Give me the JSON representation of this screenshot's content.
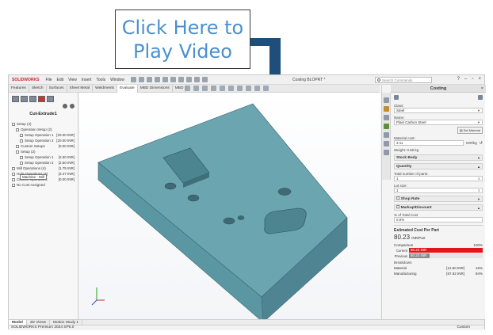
{
  "callout": {
    "line1": "Click Here to",
    "line2": "Play Video"
  },
  "titlebar": {
    "logo": "SOLIDWORKS",
    "menu": [
      "File",
      "Edit",
      "View",
      "Insert",
      "Tools",
      "Window"
    ],
    "document_title": "Costing BLOPRT *",
    "search_placeholder": "Search Commands",
    "controls": [
      "?",
      "–",
      "▫",
      "×"
    ]
  },
  "command_tabs": [
    "Features",
    "Sketch",
    "Surfaces",
    "Sheet Metal",
    "Weldments",
    "Evaluate",
    "MBD Dimensions",
    "MBD"
  ],
  "left_panel": {
    "feature_title": "Cut-Extrude1",
    "tooltip": "Machine - Mill",
    "tree": [
      {
        "label": "Setup (4)",
        "cost": "",
        "indent": 0
      },
      {
        "label": "Operation Setup (2)",
        "cost": "",
        "indent": 1
      },
      {
        "label": "Setup Operation 1",
        "cost": "[20.00 INR]",
        "indent": 2
      },
      {
        "label": "Setup Operation 2",
        "cost": "[20.00 INR]",
        "indent": 2
      },
      {
        "label": "Custom Setups",
        "cost": "[0.00 INR]",
        "indent": 1
      },
      {
        "label": "Setup (2)",
        "cost": "",
        "indent": 1
      },
      {
        "label": "Setup Operation 1",
        "cost": "[2.50 INR]",
        "indent": 2
      },
      {
        "label": "Setup Operation 2",
        "cost": "[2.50 INR]",
        "indent": 2
      },
      {
        "label": "Mill Operations (4)",
        "cost": "[1.75 INR]",
        "indent": 0
      },
      {
        "label": "Hole Operations (4)",
        "cost": "[3.47 INR]",
        "indent": 0
      },
      {
        "label": "Custom Operations",
        "cost": "[0.00 INR]",
        "indent": 0
      },
      {
        "label": "No Cost Assigned",
        "cost": "",
        "indent": 0
      }
    ]
  },
  "right_panel": {
    "title": "Costing",
    "class_label": "Class:",
    "class_value": "Steel",
    "name_label": "Name:",
    "name_value": "Plain Carbon Steel",
    "set_material": "Set Material",
    "material_cost_label": "Material cost:",
    "material_cost_value": "3.11",
    "material_cost_unit": "INR/kg",
    "weight_label": "Weight: 0.69 kg",
    "stock_body": "Stock Body",
    "quantity": "Quantity",
    "total_parts_label": "Total number of parts:",
    "total_parts_value": "1",
    "lot_size_label": "Lot size:",
    "lot_size_value": "1",
    "shop_rate": "Shop Rate",
    "markup": "Markup/Discount",
    "pct_total_cost": "% of Total Cost",
    "pct_value": "0.0%",
    "estimated_title": "Estimated Cost Per Part",
    "estimated_value": "80.23",
    "estimated_unit": "INR/Part",
    "comparison_label": "Comparison",
    "comparison_pct": "100%",
    "bars": [
      {
        "name": "Current",
        "label": "80.23 INR",
        "fraction": 1.0,
        "color": "#e3151a"
      },
      {
        "name": "Previous",
        "label": "80.23 INR",
        "fraction": 0.28,
        "color": "#8a8a8a"
      }
    ],
    "breakdown_label": "Breakdown",
    "breakdown": [
      {
        "name": "Material",
        "value": "[12.60 INR]",
        "pct": "16%"
      },
      {
        "name": "Manufacturing",
        "value": "[67.62 INR]",
        "pct": "84%"
      }
    ]
  },
  "bottom_tabs": [
    "Model",
    "3D Views",
    "Motion Study 1"
  ],
  "status": {
    "left": "SOLIDWORKS Premium 2024 SP5.0",
    "right": "Custom"
  },
  "colors": {
    "part_face": "#6aa5b0",
    "part_front": "#5b8d98",
    "part_right": "#7a9aa0",
    "accent_red": "#e3151a",
    "callout_text": "#4a8fd0"
  }
}
